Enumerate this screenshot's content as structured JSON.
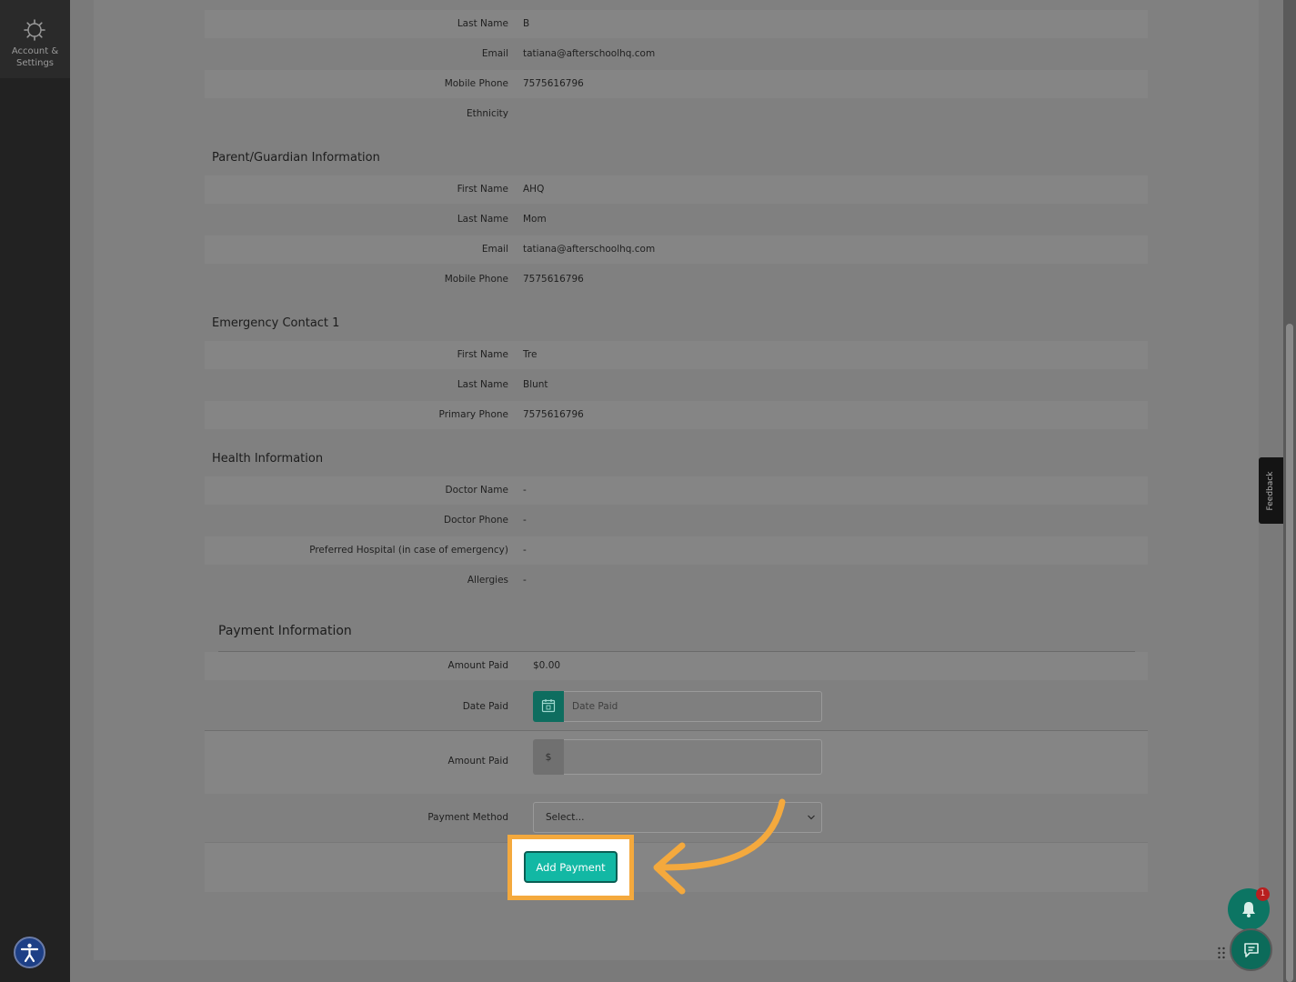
{
  "sidebar": {
    "account_settings": {
      "icon": "gear-icon",
      "label": "Account & Settings"
    }
  },
  "student": {
    "rows": [
      {
        "label": "Last Name",
        "value": "B"
      },
      {
        "label": "Email",
        "value": "tatiana@afterschoolhq.com"
      },
      {
        "label": "Mobile Phone",
        "value": "7575616796"
      },
      {
        "label": "Ethnicity",
        "value": ""
      }
    ]
  },
  "parent": {
    "title": "Parent/Guardian Information",
    "rows": [
      {
        "label": "First Name",
        "value": "AHQ"
      },
      {
        "label": "Last Name",
        "value": "Mom"
      },
      {
        "label": "Email",
        "value": "tatiana@afterschoolhq.com"
      },
      {
        "label": "Mobile Phone",
        "value": "7575616796"
      }
    ]
  },
  "emergency": {
    "title": "Emergency Contact 1",
    "rows": [
      {
        "label": "First Name",
        "value": "Tre"
      },
      {
        "label": "Last Name",
        "value": "Blunt"
      },
      {
        "label": "Primary Phone",
        "value": "7575616796"
      }
    ]
  },
  "health": {
    "title": "Health Information",
    "rows": [
      {
        "label": "Doctor Name",
        "value": "-"
      },
      {
        "label": "Doctor Phone",
        "value": "-"
      },
      {
        "label": "Preferred Hospital (in case of emergency)",
        "value": "-"
      },
      {
        "label": "Allergies",
        "value": "-"
      }
    ]
  },
  "payment": {
    "title": "Payment Information",
    "amount_paid_label": "Amount Paid",
    "amount_paid_value": "$0.00",
    "date_paid_label": "Date Paid",
    "date_paid_placeholder": "Date Paid",
    "amount_input_label": "Amount Paid",
    "currency_symbol": "$",
    "method_label": "Payment Method",
    "method_selected": "Select...",
    "add_button": "Add Payment"
  },
  "widgets": {
    "feedback_label": "Feedback",
    "notification_count": "1"
  },
  "colors": {
    "accent": "#12b8a4",
    "highlight": "#f4a93d",
    "sidebar": "#222222"
  }
}
